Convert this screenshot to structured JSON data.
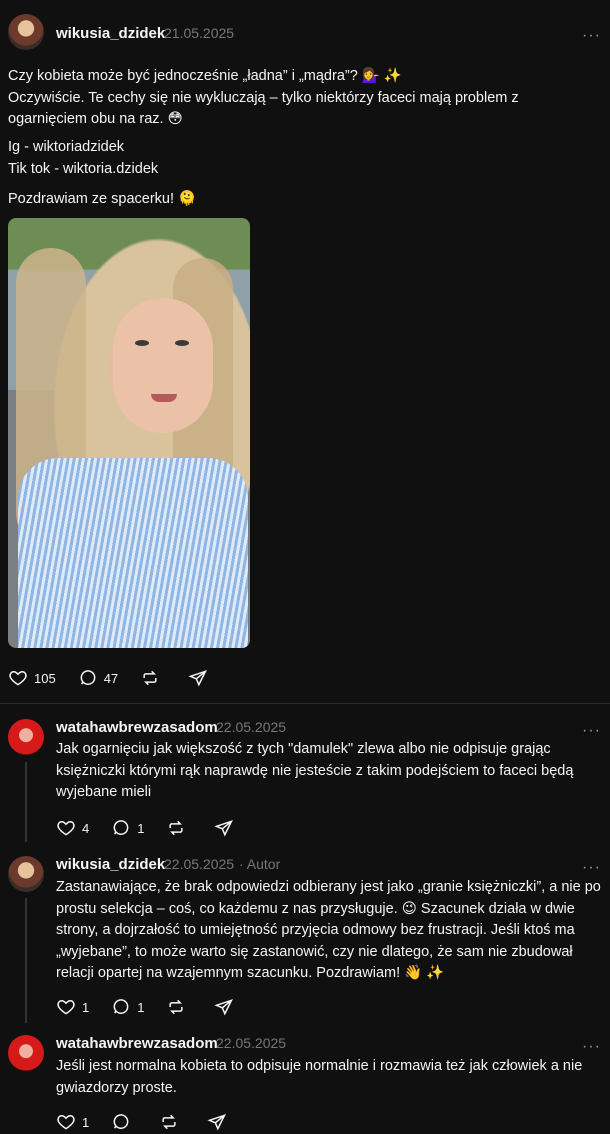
{
  "posts": [
    {
      "username": "wikusia_dzidek",
      "date": "21.05.2025",
      "paragraphs": [
        "Czy kobieta może być jednocześnie „ładna” i „mądra”? 💁‍♀️ ✨\nOczywiście. Te cechy się nie wykluczają – tylko niektórzy faceci mają problem z ogarnięciem obu na raz. 😳",
        "Ig - wiktoriadzidek\nTik tok - wiktoria.dzidek",
        "Pozdrawiam ze spacerku! 🫠"
      ],
      "image_alt": "selfie photo",
      "likes": "105",
      "comments": "47"
    }
  ],
  "replies": [
    {
      "username": "watahawbrewzasadom",
      "date": "22.05.2025",
      "author_tag": "",
      "text": "Jak ogarnięciu jak większość z tych \"damulek\" zlewa albo nie odpisuje grając księżniczki którymi rąk naprawdę nie jesteście z takim podejściem to faceci będą wyjebane mieli",
      "likes": "4",
      "comments": "1"
    },
    {
      "username": "wikusia_dzidek",
      "date": "22.05.2025",
      "author_tag": "Autor",
      "text": "Zastanawiające, że brak odpowiedzi odbierany jest jako „granie księżniczki”, a nie po prostu selekcja – coś, co każdemu z nas przysługuje. 😉 Szacunek działa w dwie strony, a dojrzałość to umiejętność przyjęcia odmowy bez frustracji. Jeśli ktoś ma „wyjebane”, to może warto się zastanowić, czy nie dlatego, że sam nie zbudował relacji opartej na wzajemnym szacunku. Pozdrawiam! 👋 ✨",
      "likes": "1",
      "comments": "1"
    },
    {
      "username": "watahawbrewzasadom",
      "date": "22.05.2025",
      "author_tag": "",
      "text": "Jeśli jest normalna kobieta to odpisuje normalnie i rozmawia też jak człowiek a nie gwiazdorzy proste.",
      "likes": "1",
      "comments": ""
    }
  ],
  "ui": {
    "more_label": "···",
    "icons": [
      "heart-icon",
      "comment-icon",
      "repost-icon",
      "share-icon",
      "more-icon"
    ]
  }
}
